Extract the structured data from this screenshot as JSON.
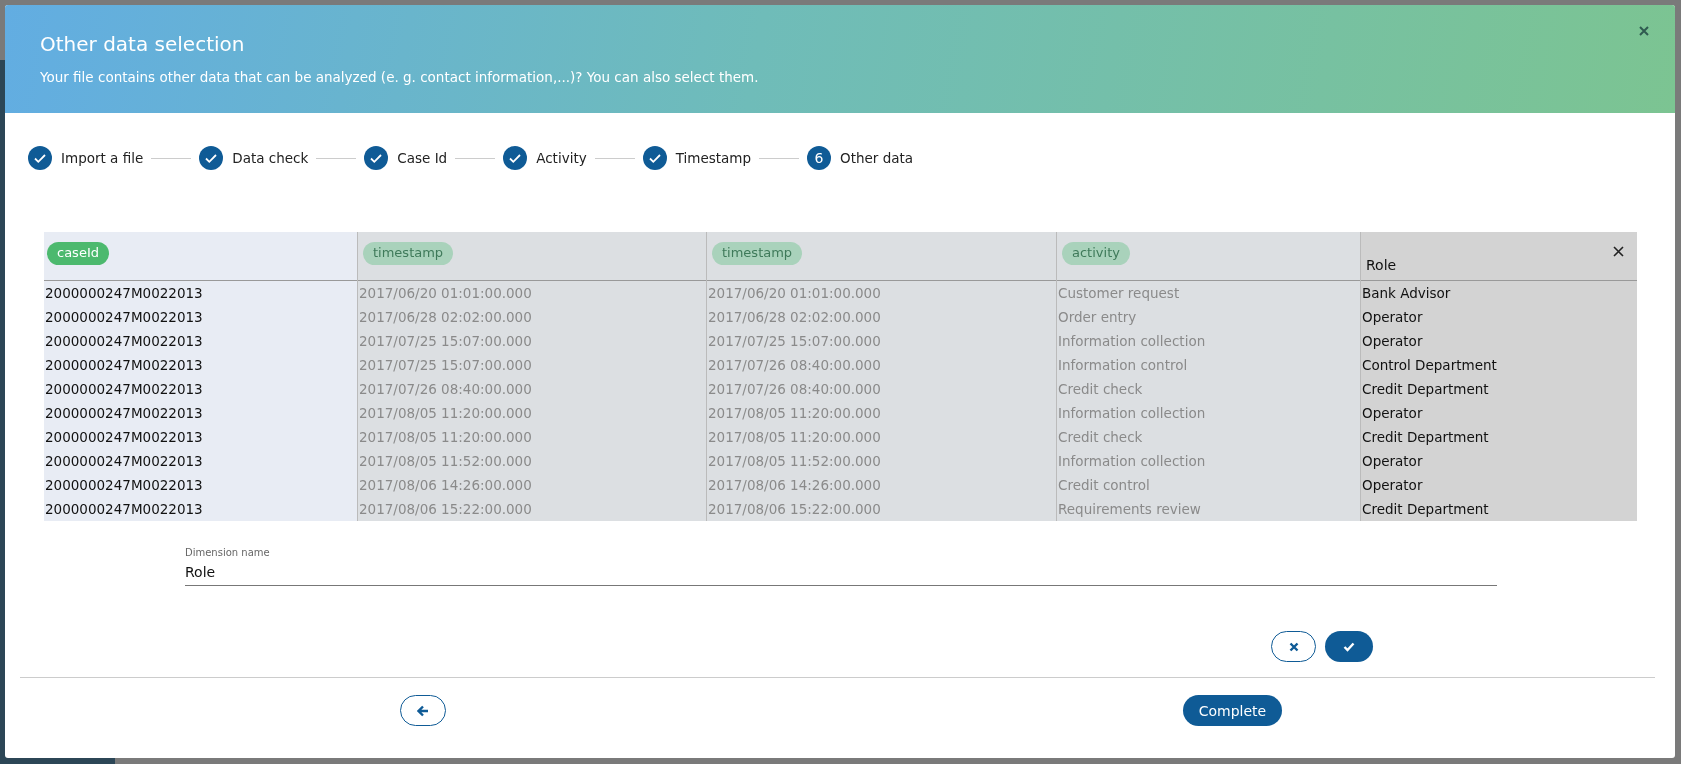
{
  "dialog": {
    "title": "Other data selection",
    "subtitle": "Your file contains other data that can be analyzed (e. g. contact information,...)? You can also select them."
  },
  "steps": [
    {
      "label": "Import a file",
      "done": true
    },
    {
      "label": "Data check",
      "done": true
    },
    {
      "label": "Case Id",
      "done": true
    },
    {
      "label": "Activity",
      "done": true
    },
    {
      "label": "Timestamp",
      "done": true
    },
    {
      "label": "Other data",
      "done": false,
      "number": "6"
    }
  ],
  "table": {
    "columns": [
      {
        "kind": "badge",
        "label": "caseId",
        "dimmed": false,
        "selected": false
      },
      {
        "kind": "badge",
        "label": "timestamp",
        "dimmed": true,
        "selected": false
      },
      {
        "kind": "badge",
        "label": "timestamp",
        "dimmed": true,
        "selected": false
      },
      {
        "kind": "badge",
        "label": "activity",
        "dimmed": true,
        "selected": false
      },
      {
        "kind": "title",
        "label": "Role",
        "dimmed": false,
        "selected": true
      }
    ],
    "rows": [
      [
        "2000000247M0022013",
        "2017/06/20 01:01:00.000",
        "2017/06/20 01:01:00.000",
        "Customer request",
        "Bank Advisor"
      ],
      [
        "2000000247M0022013",
        "2017/06/28 02:02:00.000",
        "2017/06/28 02:02:00.000",
        "Order entry",
        "Operator"
      ],
      [
        "2000000247M0022013",
        "2017/07/25 15:07:00.000",
        "2017/07/25 15:07:00.000",
        "Information collection",
        "Operator"
      ],
      [
        "2000000247M0022013",
        "2017/07/25 15:07:00.000",
        "2017/07/26 08:40:00.000",
        "Information control",
        "Control Department"
      ],
      [
        "2000000247M0022013",
        "2017/07/26 08:40:00.000",
        "2017/07/26 08:40:00.000",
        "Credit check",
        "Credit Department"
      ],
      [
        "2000000247M0022013",
        "2017/08/05 11:20:00.000",
        "2017/08/05 11:20:00.000",
        "Information collection",
        "Operator"
      ],
      [
        "2000000247M0022013",
        "2017/08/05 11:20:00.000",
        "2017/08/05 11:20:00.000",
        "Credit check",
        "Credit Department"
      ],
      [
        "2000000247M0022013",
        "2017/08/05 11:52:00.000",
        "2017/08/05 11:52:00.000",
        "Information collection",
        "Operator"
      ],
      [
        "2000000247M0022013",
        "2017/08/06 14:26:00.000",
        "2017/08/06 14:26:00.000",
        "Credit control",
        "Operator"
      ],
      [
        "2000000247M0022013",
        "2017/08/06 15:22:00.000",
        "2017/08/06 15:22:00.000",
        "Requirements review",
        "Credit Department"
      ]
    ]
  },
  "dimension_field": {
    "label": "Dimension name",
    "value": "Role"
  },
  "footer": {
    "complete_button": "Complete"
  }
}
